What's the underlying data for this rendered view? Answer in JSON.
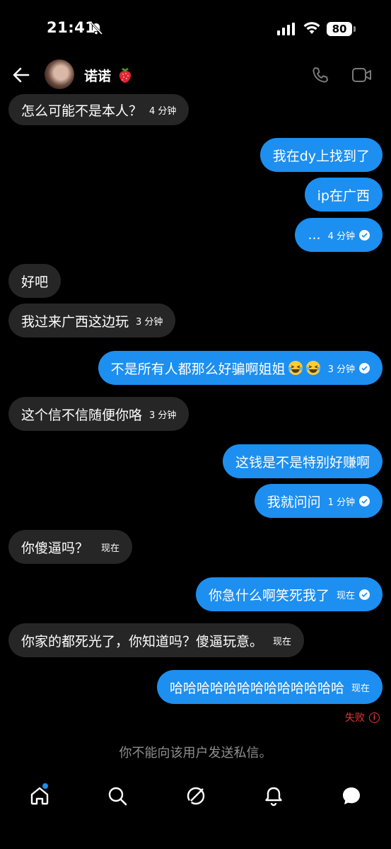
{
  "status_bar": {
    "time": "21:41",
    "battery": "80"
  },
  "header": {
    "contact_name": "诺诺"
  },
  "messages": [
    {
      "text": "怎么可能不是本人？",
      "time": "4 分钟"
    },
    {
      "text": "我在dy上找到了"
    },
    {
      "text": "ip在广西"
    },
    {
      "text": "...",
      "time": "4 分钟"
    },
    {
      "text": "好吧"
    },
    {
      "text": "我过来广西这边玩",
      "time": "3 分钟"
    },
    {
      "text": "不是所有人都那么好骗啊姐姐",
      "time": "3 分钟"
    },
    {
      "text": "这个信不信随便你咯",
      "time": "3 分钟"
    },
    {
      "text": "这钱是不是特别好赚啊"
    },
    {
      "text": "我就问问",
      "time": "1 分钟"
    },
    {
      "text": "你傻逼吗？",
      "time": "现在"
    },
    {
      "text": "你急什么啊笑死我了",
      "time": "现在"
    },
    {
      "text": "你家的都死光了，你知道吗？傻逼玩意。",
      "time": "现在"
    },
    {
      "text": "哈哈哈哈哈哈哈哈哈哈哈哈哈",
      "time": "现在"
    }
  ],
  "failed_label": "失败",
  "notice": "你不能向该用户发送私信。",
  "colors": {
    "outgoing_bubble": "#1d8ff0",
    "incoming_bubble": "#262626",
    "error": "#e5383b"
  },
  "icons": [
    "back-arrow-icon",
    "strawberry-icon",
    "phone-icon",
    "video-icon",
    "home-icon",
    "search-icon",
    "explore-icon",
    "bell-icon",
    "chat-icon"
  ]
}
